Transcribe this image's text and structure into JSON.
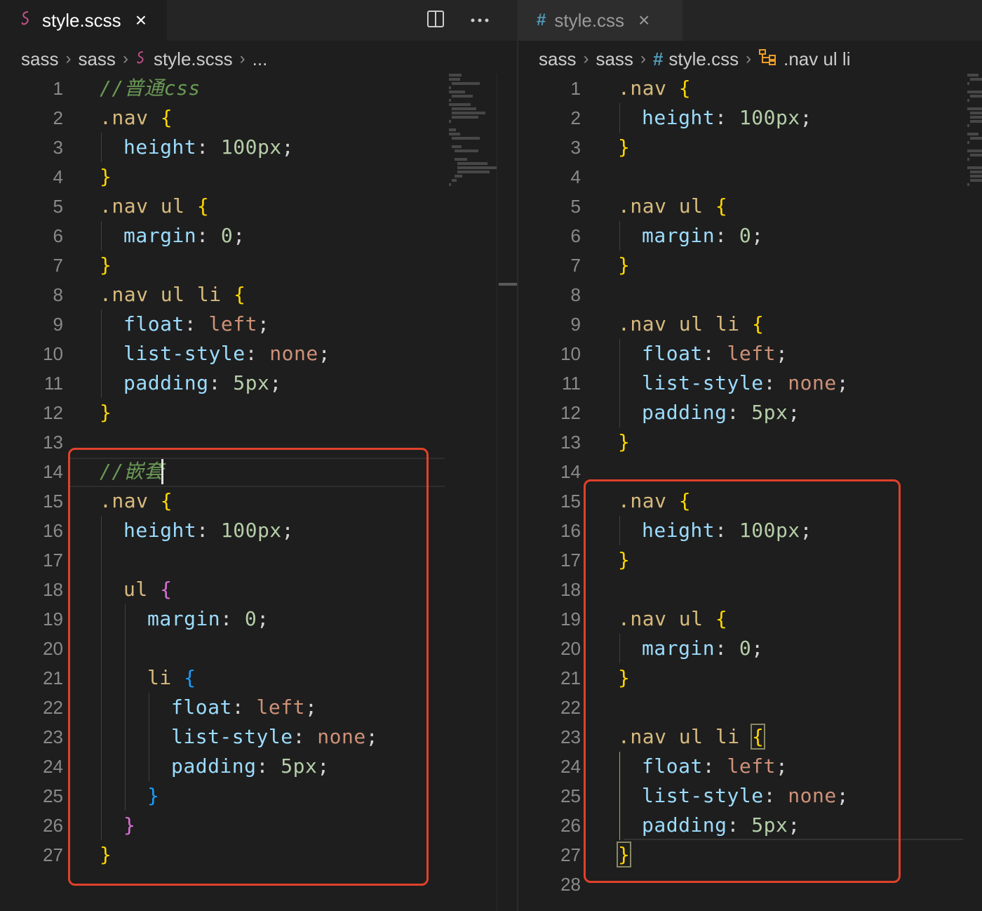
{
  "left": {
    "tab": {
      "icon": "sass-icon",
      "label": "style.scss",
      "close": "×"
    },
    "breadcrumb": [
      "sass",
      "sass",
      "style.scss",
      "..."
    ],
    "lines": [
      {
        "n": "1",
        "tokens": [
          {
            "t": "//普通css",
            "c": "comment"
          }
        ],
        "indent": 0
      },
      {
        "n": "2",
        "tokens": [
          {
            "t": ".nav ",
            "c": "sel"
          },
          {
            "t": "{",
            "c": "b1"
          }
        ],
        "indent": 0
      },
      {
        "n": "3",
        "tokens": [
          {
            "t": "height",
            "c": "prop"
          },
          {
            "t": ": ",
            "c": "punc"
          },
          {
            "t": "100px",
            "c": "num"
          },
          {
            "t": ";",
            "c": "punc"
          }
        ],
        "indent": 1
      },
      {
        "n": "4",
        "tokens": [
          {
            "t": "}",
            "c": "b1"
          }
        ],
        "indent": 0
      },
      {
        "n": "5",
        "tokens": [
          {
            "t": ".nav ul ",
            "c": "sel"
          },
          {
            "t": "{",
            "c": "b1"
          }
        ],
        "indent": 0
      },
      {
        "n": "6",
        "tokens": [
          {
            "t": "margin",
            "c": "prop"
          },
          {
            "t": ": ",
            "c": "punc"
          },
          {
            "t": "0",
            "c": "num"
          },
          {
            "t": ";",
            "c": "punc"
          }
        ],
        "indent": 1
      },
      {
        "n": "7",
        "tokens": [
          {
            "t": "}",
            "c": "b1"
          }
        ],
        "indent": 0
      },
      {
        "n": "8",
        "tokens": [
          {
            "t": ".nav ul li ",
            "c": "sel"
          },
          {
            "t": "{",
            "c": "b1"
          }
        ],
        "indent": 0
      },
      {
        "n": "9",
        "tokens": [
          {
            "t": "float",
            "c": "prop"
          },
          {
            "t": ": ",
            "c": "punc"
          },
          {
            "t": "left",
            "c": "val"
          },
          {
            "t": ";",
            "c": "punc"
          }
        ],
        "indent": 1
      },
      {
        "n": "10",
        "tokens": [
          {
            "t": "list-style",
            "c": "prop"
          },
          {
            "t": ": ",
            "c": "punc"
          },
          {
            "t": "none",
            "c": "val"
          },
          {
            "t": ";",
            "c": "punc"
          }
        ],
        "indent": 1
      },
      {
        "n": "11",
        "tokens": [
          {
            "t": "padding",
            "c": "prop"
          },
          {
            "t": ": ",
            "c": "punc"
          },
          {
            "t": "5px",
            "c": "num"
          },
          {
            "t": ";",
            "c": "punc"
          }
        ],
        "indent": 1
      },
      {
        "n": "12",
        "tokens": [
          {
            "t": "}",
            "c": "b1"
          }
        ],
        "indent": 0
      },
      {
        "n": "13",
        "tokens": [],
        "indent": 0
      },
      {
        "n": "14",
        "tokens": [
          {
            "t": "//嵌套",
            "c": "comment"
          }
        ],
        "indent": 0
      },
      {
        "n": "15",
        "tokens": [
          {
            "t": ".nav ",
            "c": "sel"
          },
          {
            "t": "{",
            "c": "b1"
          }
        ],
        "indent": 0
      },
      {
        "n": "16",
        "tokens": [
          {
            "t": "height",
            "c": "prop"
          },
          {
            "t": ": ",
            "c": "punc"
          },
          {
            "t": "100px",
            "c": "num"
          },
          {
            "t": ";",
            "c": "punc"
          }
        ],
        "indent": 1
      },
      {
        "n": "17",
        "tokens": [],
        "indent": 0
      },
      {
        "n": "18",
        "tokens": [
          {
            "t": "ul ",
            "c": "tag"
          },
          {
            "t": "{",
            "c": "b2"
          }
        ],
        "indent": 1
      },
      {
        "n": "19",
        "tokens": [
          {
            "t": "margin",
            "c": "prop"
          },
          {
            "t": ": ",
            "c": "punc"
          },
          {
            "t": "0",
            "c": "num"
          },
          {
            "t": ";",
            "c": "punc"
          }
        ],
        "indent": 2
      },
      {
        "n": "20",
        "tokens": [],
        "indent": 0
      },
      {
        "n": "21",
        "tokens": [
          {
            "t": "li ",
            "c": "tag"
          },
          {
            "t": "{",
            "c": "b3"
          }
        ],
        "indent": 2
      },
      {
        "n": "22",
        "tokens": [
          {
            "t": "float",
            "c": "prop"
          },
          {
            "t": ": ",
            "c": "punc"
          },
          {
            "t": "left",
            "c": "val"
          },
          {
            "t": ";",
            "c": "punc"
          }
        ],
        "indent": 3
      },
      {
        "n": "23",
        "tokens": [
          {
            "t": "list-style",
            "c": "prop"
          },
          {
            "t": ": ",
            "c": "punc"
          },
          {
            "t": "none",
            "c": "val"
          },
          {
            "t": ";",
            "c": "punc"
          }
        ],
        "indent": 3
      },
      {
        "n": "24",
        "tokens": [
          {
            "t": "padding",
            "c": "prop"
          },
          {
            "t": ": ",
            "c": "punc"
          },
          {
            "t": "5px",
            "c": "num"
          },
          {
            "t": ";",
            "c": "punc"
          }
        ],
        "indent": 3
      },
      {
        "n": "25",
        "tokens": [
          {
            "t": "}",
            "c": "b3"
          }
        ],
        "indent": 2
      },
      {
        "n": "26",
        "tokens": [
          {
            "t": "}",
            "c": "b2"
          }
        ],
        "indent": 1
      },
      {
        "n": "27",
        "tokens": [
          {
            "t": "}",
            "c": "b1"
          }
        ],
        "indent": 0
      }
    ]
  },
  "right": {
    "tab": {
      "icon": "css-hash-icon",
      "label": "style.css",
      "close": "×"
    },
    "breadcrumb": [
      "sass",
      "sass",
      "style.css",
      ".nav ul li"
    ],
    "lines": [
      {
        "n": "1",
        "tokens": [
          {
            "t": ".nav ",
            "c": "sel"
          },
          {
            "t": "{",
            "c": "b1"
          }
        ],
        "indent": 0
      },
      {
        "n": "2",
        "tokens": [
          {
            "t": "height",
            "c": "prop"
          },
          {
            "t": ": ",
            "c": "punc"
          },
          {
            "t": "100px",
            "c": "num"
          },
          {
            "t": ";",
            "c": "punc"
          }
        ],
        "indent": 1
      },
      {
        "n": "3",
        "tokens": [
          {
            "t": "}",
            "c": "b1"
          }
        ],
        "indent": 0
      },
      {
        "n": "4",
        "tokens": [],
        "indent": 0
      },
      {
        "n": "5",
        "tokens": [
          {
            "t": ".nav ul ",
            "c": "sel"
          },
          {
            "t": "{",
            "c": "b1"
          }
        ],
        "indent": 0
      },
      {
        "n": "6",
        "tokens": [
          {
            "t": "margin",
            "c": "prop"
          },
          {
            "t": ": ",
            "c": "punc"
          },
          {
            "t": "0",
            "c": "num"
          },
          {
            "t": ";",
            "c": "punc"
          }
        ],
        "indent": 1
      },
      {
        "n": "7",
        "tokens": [
          {
            "t": "}",
            "c": "b1"
          }
        ],
        "indent": 0
      },
      {
        "n": "8",
        "tokens": [],
        "indent": 0
      },
      {
        "n": "9",
        "tokens": [
          {
            "t": ".nav ul li ",
            "c": "sel"
          },
          {
            "t": "{",
            "c": "b1"
          }
        ],
        "indent": 0
      },
      {
        "n": "10",
        "tokens": [
          {
            "t": "float",
            "c": "prop"
          },
          {
            "t": ": ",
            "c": "punc"
          },
          {
            "t": "left",
            "c": "val"
          },
          {
            "t": ";",
            "c": "punc"
          }
        ],
        "indent": 1
      },
      {
        "n": "11",
        "tokens": [
          {
            "t": "list-style",
            "c": "prop"
          },
          {
            "t": ": ",
            "c": "punc"
          },
          {
            "t": "none",
            "c": "val"
          },
          {
            "t": ";",
            "c": "punc"
          }
        ],
        "indent": 1
      },
      {
        "n": "12",
        "tokens": [
          {
            "t": "padding",
            "c": "prop"
          },
          {
            "t": ": ",
            "c": "punc"
          },
          {
            "t": "5px",
            "c": "num"
          },
          {
            "t": ";",
            "c": "punc"
          }
        ],
        "indent": 1
      },
      {
        "n": "13",
        "tokens": [
          {
            "t": "}",
            "c": "b1"
          }
        ],
        "indent": 0
      },
      {
        "n": "14",
        "tokens": [],
        "indent": 0
      },
      {
        "n": "15",
        "tokens": [
          {
            "t": ".nav ",
            "c": "sel"
          },
          {
            "t": "{",
            "c": "b1"
          }
        ],
        "indent": 0
      },
      {
        "n": "16",
        "tokens": [
          {
            "t": "height",
            "c": "prop"
          },
          {
            "t": ": ",
            "c": "punc"
          },
          {
            "t": "100px",
            "c": "num"
          },
          {
            "t": ";",
            "c": "punc"
          }
        ],
        "indent": 1
      },
      {
        "n": "17",
        "tokens": [
          {
            "t": "}",
            "c": "b1"
          }
        ],
        "indent": 0
      },
      {
        "n": "18",
        "tokens": [],
        "indent": 0
      },
      {
        "n": "19",
        "tokens": [
          {
            "t": ".nav ul ",
            "c": "sel"
          },
          {
            "t": "{",
            "c": "b1"
          }
        ],
        "indent": 0
      },
      {
        "n": "20",
        "tokens": [
          {
            "t": "margin",
            "c": "prop"
          },
          {
            "t": ": ",
            "c": "punc"
          },
          {
            "t": "0",
            "c": "num"
          },
          {
            "t": ";",
            "c": "punc"
          }
        ],
        "indent": 1
      },
      {
        "n": "21",
        "tokens": [
          {
            "t": "}",
            "c": "b1"
          }
        ],
        "indent": 0
      },
      {
        "n": "22",
        "tokens": [],
        "indent": 0
      },
      {
        "n": "23",
        "tokens": [
          {
            "t": ".nav ul li ",
            "c": "sel"
          },
          {
            "t": "{",
            "c": "b1m"
          }
        ],
        "indent": 0
      },
      {
        "n": "24",
        "tokens": [
          {
            "t": "float",
            "c": "prop"
          },
          {
            "t": ": ",
            "c": "punc"
          },
          {
            "t": "left",
            "c": "val"
          },
          {
            "t": ";",
            "c": "punc"
          }
        ],
        "indent": 1
      },
      {
        "n": "25",
        "tokens": [
          {
            "t": "list-style",
            "c": "prop"
          },
          {
            "t": ": ",
            "c": "punc"
          },
          {
            "t": "none",
            "c": "val"
          },
          {
            "t": ";",
            "c": "punc"
          }
        ],
        "indent": 1
      },
      {
        "n": "26",
        "tokens": [
          {
            "t": "padding",
            "c": "prop"
          },
          {
            "t": ": ",
            "c": "punc"
          },
          {
            "t": "5px",
            "c": "num"
          },
          {
            "t": ";",
            "c": "punc"
          }
        ],
        "indent": 1
      },
      {
        "n": "27",
        "tokens": [
          {
            "t": "}",
            "c": "b1m"
          }
        ],
        "indent": 0
      },
      {
        "n": "28",
        "tokens": [],
        "indent": 0
      }
    ]
  },
  "colors": {
    "highlight": "#e0412b",
    "comment": "#6a9955",
    "selector": "#d7ba7d",
    "property": "#9cdcfe",
    "number": "#b5cea8",
    "value": "#ce9178",
    "bracket1": "#ffd700",
    "bracket2": "#da70d6",
    "bracket3": "#179fff"
  },
  "icons": {
    "split": "split-editor-icon",
    "more": "more-actions-icon",
    "symbol": "symbol-structure-icon"
  }
}
